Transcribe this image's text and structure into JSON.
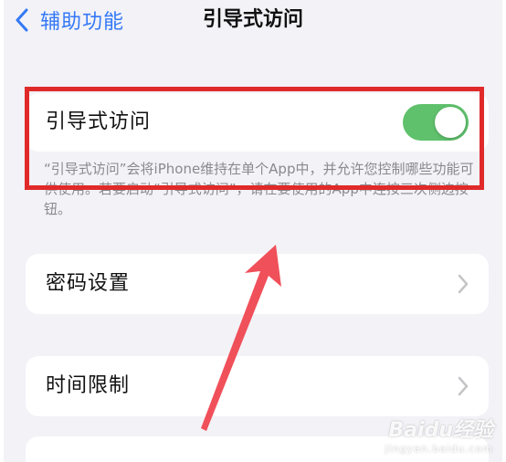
{
  "nav": {
    "back_label": "辅助功能",
    "title": "引导式访问"
  },
  "guided_access": {
    "label": "引导式访问",
    "toggle_on": true,
    "toggle_color": "#5fc16c",
    "description": "“引导式访问”会将iPhone维持在单个App中，并允许您控制哪些功能可供使用。若要启动“引导式访问”，请在要使用的App中连按三次侧边按钮。"
  },
  "rows": [
    {
      "label": "密码设置",
      "icon": "chevron-right-icon"
    },
    {
      "label": "时间限制",
      "icon": "chevron-right-icon"
    }
  ],
  "annotation": {
    "highlight_color": "#e02a2a",
    "arrow_color": "#f0505a"
  },
  "watermark": {
    "logo": "Baidu经验",
    "sub": "jingyan.baidu.com"
  },
  "colors": {
    "accent": "#3478f6",
    "background": "#f2f2f7"
  }
}
